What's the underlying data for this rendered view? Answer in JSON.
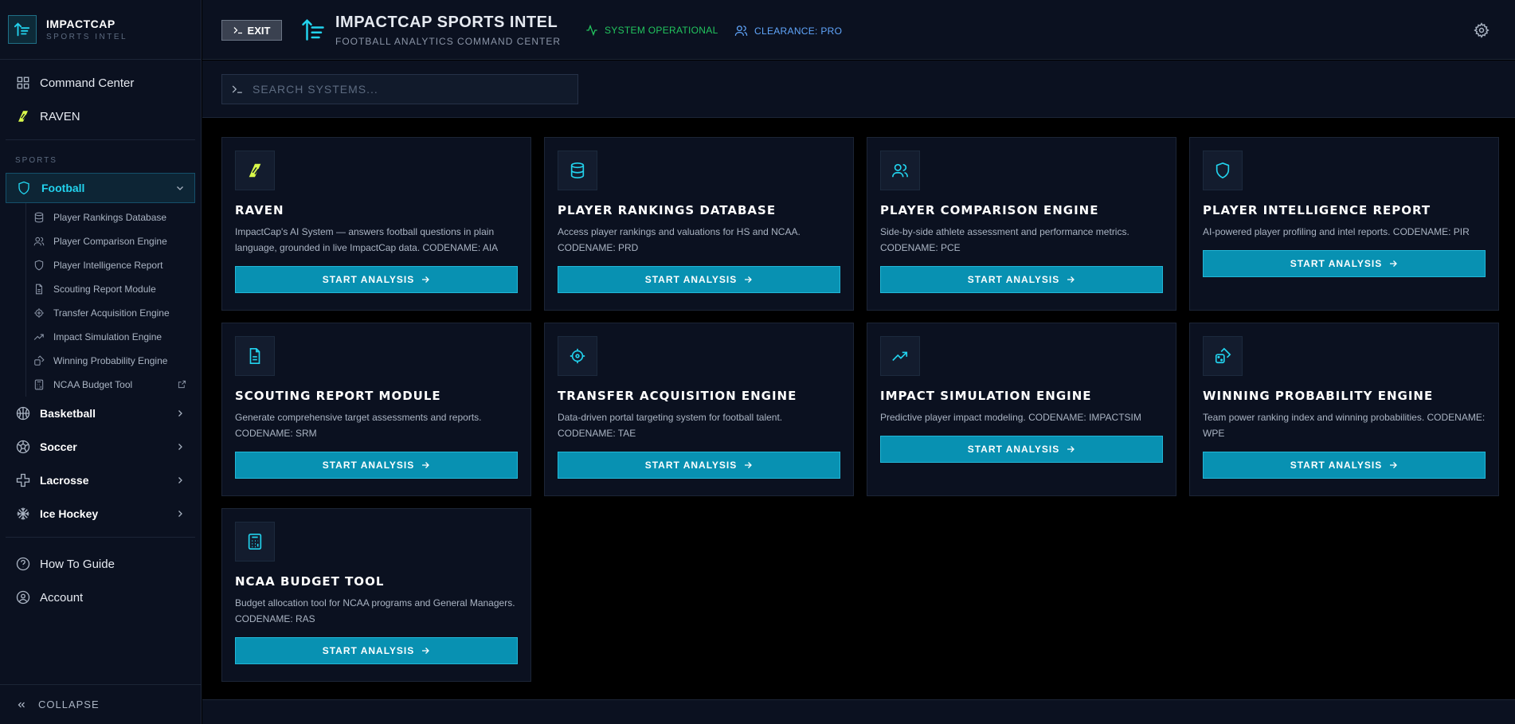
{
  "brand": {
    "name": "IMPACTCAP",
    "sub": "SPORTS INTEL"
  },
  "nav": {
    "command_center": "Command Center",
    "raven": "RAVEN",
    "sports_label": "SPORTS",
    "football": "Football",
    "football_items": [
      {
        "label": "Player Rankings Database",
        "icon": "database-icon"
      },
      {
        "label": "Player Comparison Engine",
        "icon": "users-icon"
      },
      {
        "label": "Player Intelligence Report",
        "icon": "shield-icon"
      },
      {
        "label": "Scouting Report Module",
        "icon": "document-icon"
      },
      {
        "label": "Transfer Acquisition Engine",
        "icon": "crosshair-icon"
      },
      {
        "label": "Impact Simulation Engine",
        "icon": "trending-up-icon"
      },
      {
        "label": "Winning Probability Engine",
        "icon": "dice-icon"
      },
      {
        "label": "NCAA Budget Tool",
        "icon": "calculator-icon"
      }
    ],
    "sports": [
      "Basketball",
      "Soccer",
      "Lacrosse",
      "Ice Hockey"
    ],
    "how_to": "How To Guide",
    "account": "Account",
    "collapse": "COLLAPSE"
  },
  "header": {
    "exit": "EXIT",
    "title": "IMPACTCAP SPORTS INTEL",
    "subtitle": "FOOTBALL ANALYTICS COMMAND CENTER",
    "status": "SYSTEM OPERATIONAL",
    "clearance": "CLEARANCE: PRO"
  },
  "search": {
    "placeholder": "SEARCH SYSTEMS..."
  },
  "cards": [
    {
      "title": "RAVEN",
      "desc": "ImpactCap's AI System — answers football questions in plain language, grounded in live ImpactCap data. CODENAME: AIA",
      "button": "START ANALYSIS",
      "icon": "raven-icon"
    },
    {
      "title": "PLAYER RANKINGS DATABASE",
      "desc": "Access player rankings and valuations for HS and NCAA. CODENAME: PRD",
      "button": "START ANALYSIS",
      "icon": "database-icon"
    },
    {
      "title": "PLAYER COMPARISON ENGINE",
      "desc": "Side-by-side athlete assessment and performance metrics. CODENAME: PCE",
      "button": "START ANALYSIS",
      "icon": "users-icon"
    },
    {
      "title": "PLAYER INTELLIGENCE REPORT",
      "desc": "AI-powered player profiling and intel reports. CODENAME: PIR",
      "button": "START ANALYSIS",
      "icon": "shield-icon"
    },
    {
      "title": "SCOUTING REPORT MODULE",
      "desc": "Generate comprehensive target assessments and reports. CODENAME: SRM",
      "button": "START ANALYSIS",
      "icon": "document-icon"
    },
    {
      "title": "TRANSFER ACQUISITION ENGINE",
      "desc": "Data-driven portal targeting system for football talent. CODENAME: TAE",
      "button": "START ANALYSIS",
      "icon": "crosshair-icon"
    },
    {
      "title": "IMPACT SIMULATION ENGINE",
      "desc": "Predictive player impact modeling. CODENAME: IMPACTSIM",
      "button": "START ANALYSIS",
      "icon": "trending-up-icon"
    },
    {
      "title": "WINNING PROBABILITY ENGINE",
      "desc": "Team power ranking index and winning probabilities. CODENAME: WPE",
      "button": "START ANALYSIS",
      "icon": "dice-icon"
    },
    {
      "title": "NCAA BUDGET TOOL",
      "desc": "Budget allocation tool for NCAA programs and General Managers. CODENAME: RAS",
      "button": "START ANALYSIS",
      "icon": "calculator-icon"
    }
  ],
  "colors": {
    "accent": "#22d3ee",
    "button": "#0891b2",
    "status": "#22c55e",
    "clearance": "#60a5fa",
    "raven": "#d9f94a"
  }
}
